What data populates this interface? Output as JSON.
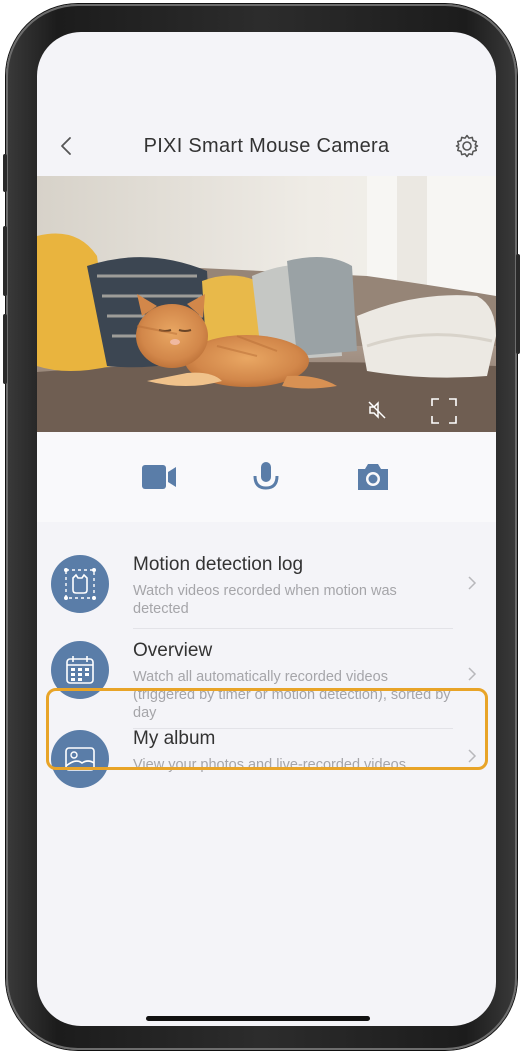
{
  "header": {
    "title": "PIXI Smart Mouse Camera",
    "back_icon": "chevron-left-icon",
    "settings_icon": "gear-icon"
  },
  "video": {
    "mute_icon": "speaker-muted-icon",
    "fullscreen_icon": "fullscreen-icon"
  },
  "controls": [
    {
      "icon": "video-camera-icon"
    },
    {
      "icon": "microphone-icon"
    },
    {
      "icon": "camera-icon"
    }
  ],
  "menu": [
    {
      "label": "Motion detection log",
      "desc": "Watch videos recorded when motion was detected",
      "icon": "motion-frame-icon"
    },
    {
      "label": "Overview",
      "desc": "Watch all automatically recorded videos (triggered by timer or motion detection), sorted by day",
      "icon": "calendar-icon"
    },
    {
      "label": "My album",
      "desc": "View your photos and live-recorded videos",
      "icon": "photo-icon"
    }
  ],
  "colors": {
    "accent": "#5a7da8",
    "highlight": "#e8a428"
  }
}
